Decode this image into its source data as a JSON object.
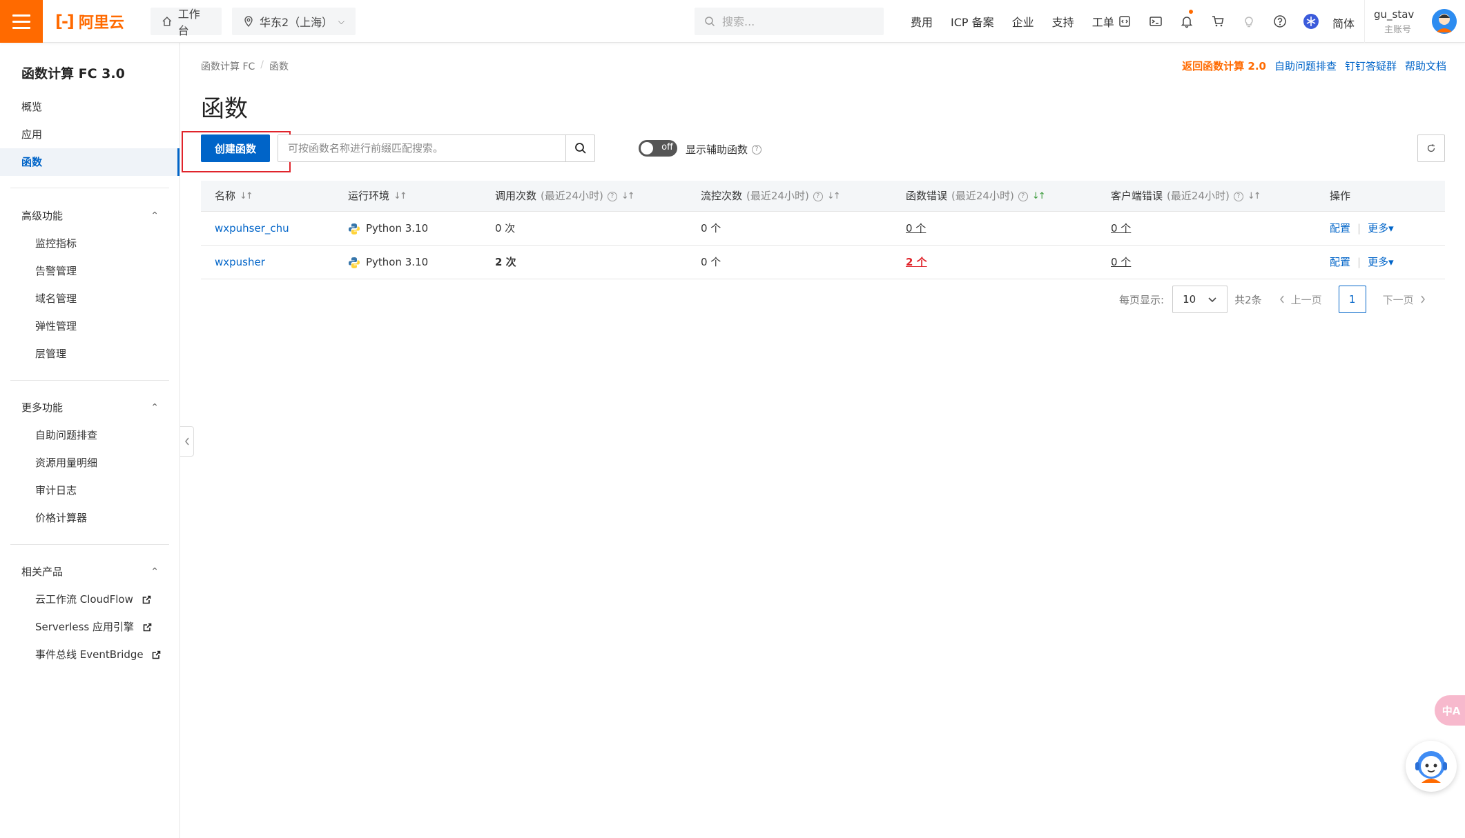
{
  "header": {
    "logo_text": "阿里云",
    "workbench": "工作台",
    "region": "华东2（上海）",
    "search_placeholder": "搜索...",
    "nav": [
      "费用",
      "ICP 备案",
      "企业",
      "支持",
      "工单"
    ],
    "lang": "简体",
    "user_name": "gu_stav",
    "user_role": "主账号"
  },
  "sidebar": {
    "title": "函数计算 FC 3.0",
    "items": [
      {
        "label": "概览"
      },
      {
        "label": "应用"
      },
      {
        "label": "函数",
        "active": true
      }
    ],
    "groups": [
      {
        "label": "高级功能",
        "items": [
          "监控指标",
          "告警管理",
          "域名管理",
          "弹性管理",
          "层管理"
        ]
      },
      {
        "label": "更多功能",
        "items": [
          "自助问题排查",
          "资源用量明细",
          "审计日志",
          "价格计算器"
        ]
      },
      {
        "label": "相关产品",
        "items": [
          "云工作流 CloudFlow",
          "Serverless 应用引擎",
          "事件总线 EventBridge"
        ]
      }
    ]
  },
  "main": {
    "breadcrumb": [
      "函数计算 FC",
      "函数"
    ],
    "top_links": [
      "返回函数计算 2.0",
      "自助问题排查",
      "钉钉答疑群",
      "帮助文档"
    ],
    "title": "函数",
    "create_button": "创建函数",
    "search_placeholder": "可按函数名称进行前缀匹配搜索。",
    "toggle_state": "off",
    "toggle_label": "显示辅助函数",
    "columns": [
      {
        "label": "名称",
        "sub": ""
      },
      {
        "label": "运行环境",
        "sub": ""
      },
      {
        "label": "调用次数",
        "sub": "(最近24小时)"
      },
      {
        "label": "流控次数",
        "sub": "(最近24小时)"
      },
      {
        "label": "函数错误",
        "sub": "(最近24小时)"
      },
      {
        "label": "客户端错误",
        "sub": "(最近24小时)"
      },
      {
        "label": "操作",
        "sub": ""
      }
    ],
    "rows": [
      {
        "name": "wxpuhser_chu",
        "runtime": "Python 3.10",
        "invocations": "0 次",
        "throttles": "0 个",
        "errors": "0 个",
        "client_errors": "0 个",
        "op_config": "配置",
        "op_more": "更多"
      },
      {
        "name": "wxpusher",
        "runtime": "Python 3.10",
        "invocations": "2 次",
        "throttles": "0 个",
        "errors": "2 个",
        "client_errors": "0 个",
        "op_config": "配置",
        "op_more": "更多"
      }
    ],
    "pager": {
      "per_page_label": "每页显示:",
      "per_page": "10",
      "total": "共2条",
      "prev": "上一页",
      "current": "1",
      "next": "下一页"
    }
  },
  "floating": {
    "translate": "中A"
  },
  "colors": {
    "brand": "#ff6a00",
    "primary": "#0064c8",
    "error": "#e0242b"
  }
}
